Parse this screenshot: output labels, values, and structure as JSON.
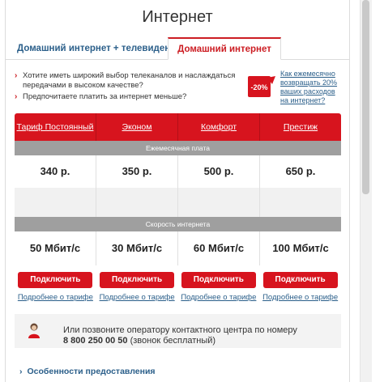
{
  "page": {
    "title": "Интернет"
  },
  "tabs": [
    {
      "label": "Домашний интернет + телевидение",
      "active": false
    },
    {
      "label": "Домашний интернет",
      "active": true
    }
  ],
  "bullets": [
    "Хотите иметь широкий выбор телеканалов и наслаждаться передачами в высоком качестве?",
    "Предпочитаете платить за интернет меньше?"
  ],
  "promo": {
    "badge": "-20%",
    "text": "Как ежемесячно возвращать 20% ваших расходов на интернет?"
  },
  "tariffs": [
    {
      "name": "Тариф Постоянный",
      "price": "340 р.",
      "speed": "50 Мбит/с"
    },
    {
      "name": "Эконом",
      "price": "350 р.",
      "speed": "30 Мбит/с"
    },
    {
      "name": "Комфорт",
      "price": "500 р.",
      "speed": "60 Мбит/с"
    },
    {
      "name": "Престиж",
      "price": "650 р.",
      "speed": "100 Мбит/с"
    }
  ],
  "sections": {
    "monthly_fee": "Ежемесячная плата",
    "speed": "Скорость интернета"
  },
  "buttons": {
    "connect": "Подключить",
    "details": "Подробнее о тарифе"
  },
  "contact": {
    "text": "Или позвоните оператору контактного центра по номеру",
    "phone": "8 800 250 00 50",
    "note": "(звонок бесплатный)"
  },
  "features": {
    "label": "Особенности предоставления"
  },
  "colors": {
    "accent": "#d7141e",
    "link": "#2b5f8a",
    "bar": "#9f9f9f"
  }
}
